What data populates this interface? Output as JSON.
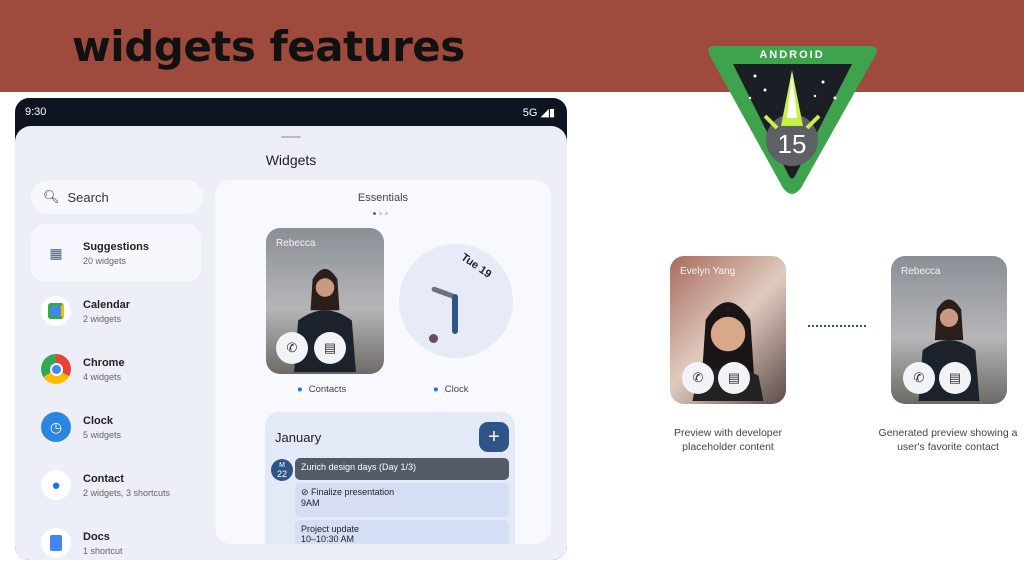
{
  "header": {
    "title": "widgets features"
  },
  "logo": {
    "text": "ANDROID",
    "version": "15"
  },
  "phone": {
    "status_time": "9:30",
    "network": "5G",
    "sheet_title": "Widgets",
    "search_placeholder": "Search",
    "categories": [
      {
        "name": "Suggestions",
        "sub": "20 widgets",
        "icon": "grid-icon"
      },
      {
        "name": "Calendar",
        "sub": "2 widgets",
        "icon": "calendar-icon"
      },
      {
        "name": "Chrome",
        "sub": "4 widgets",
        "icon": "chrome-icon"
      },
      {
        "name": "Clock",
        "sub": "5 widgets",
        "icon": "clock-icon"
      },
      {
        "name": "Contact",
        "sub": "2 widgets, 3 shortcuts",
        "icon": "contact-icon"
      },
      {
        "name": "Docs",
        "sub": "1 shortcut",
        "icon": "docs-icon"
      }
    ],
    "essentials": {
      "title": "Essentials",
      "contact_name": "Rebecca",
      "clock_date": "Tue 19",
      "contacts_label": "Contacts",
      "clock_label": "Clock"
    },
    "calendar": {
      "month": "January",
      "day_letter": "M",
      "day_num": "22",
      "events": [
        {
          "title": "Zurich design days (Day 1/3)",
          "time": ""
        },
        {
          "title": "Finalize presentation",
          "time": "9AM"
        },
        {
          "title": "Project update",
          "time": "10–10:30 AM"
        }
      ]
    }
  },
  "comparison": {
    "left": {
      "name": "Evelyn Yang",
      "caption": "Preview with developer placeholder content"
    },
    "right": {
      "name": "Rebecca",
      "caption": "Generated preview showing a user's favorite contact"
    }
  },
  "colors": {
    "banner": "#9e4b3d",
    "accent": "#2f5588",
    "logo_green": "#3fa34d"
  }
}
